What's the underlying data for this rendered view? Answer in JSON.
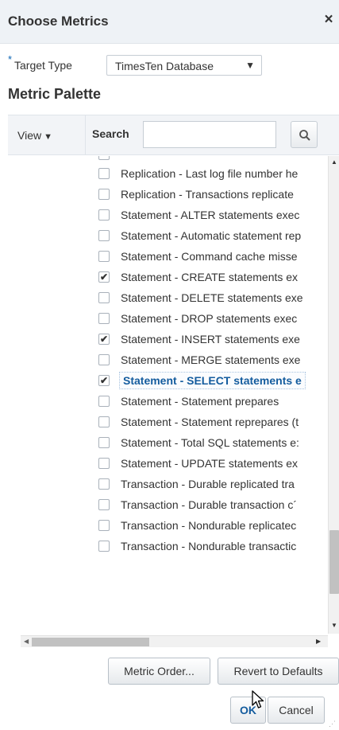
{
  "dialog": {
    "title": "Choose Metrics",
    "close_glyph": "×"
  },
  "target_type": {
    "required_marker": "*",
    "label": "Target Type",
    "selected_value": "TimesTen Database",
    "arrow_glyph": "▼"
  },
  "palette": {
    "title": "Metric Palette"
  },
  "toolbar": {
    "view_label": "View",
    "view_caret": "▼",
    "search_label": "Search",
    "search_value": ""
  },
  "metrics": [
    {
      "label": "Replication - Last log file number he",
      "checked": false
    },
    {
      "label": "Replication - Transactions replicate",
      "checked": false
    },
    {
      "label": "Statement - ALTER statements exec",
      "checked": false
    },
    {
      "label": "Statement - Automatic statement rep",
      "checked": false
    },
    {
      "label": "Statement - Command cache misse",
      "checked": false
    },
    {
      "label": "Statement - CREATE statements ex",
      "checked": true
    },
    {
      "label": "Statement - DELETE statements exe",
      "checked": false
    },
    {
      "label": "Statement - DROP statements exec",
      "checked": false
    },
    {
      "label": "Statement - INSERT statements exe",
      "checked": true
    },
    {
      "label": "Statement - MERGE statements exe",
      "checked": false
    },
    {
      "label": "Statement - SELECT statements e",
      "checked": true,
      "selected": true
    },
    {
      "label": "Statement - Statement prepares",
      "checked": false
    },
    {
      "label": "Statement - Statement reprepares (t",
      "checked": false
    },
    {
      "label": "Statement - Total SQL statements e:",
      "checked": false
    },
    {
      "label": "Statement - UPDATE statements ex",
      "checked": false
    },
    {
      "label": "Transaction - Durable replicated tra",
      "checked": false
    },
    {
      "label": "Transaction - Durable transaction c´",
      "checked": false
    },
    {
      "label": "Transaction - Nondurable replicatec",
      "checked": false
    },
    {
      "label": "Transaction - Nondurable transactic",
      "checked": false
    }
  ],
  "buttons": {
    "metric_order": "Metric Order...",
    "revert": "Revert to Defaults",
    "ok": "OK",
    "cancel": "Cancel"
  },
  "colors": {
    "accent": "#145c9e",
    "header_bg": "#eef2f6"
  }
}
